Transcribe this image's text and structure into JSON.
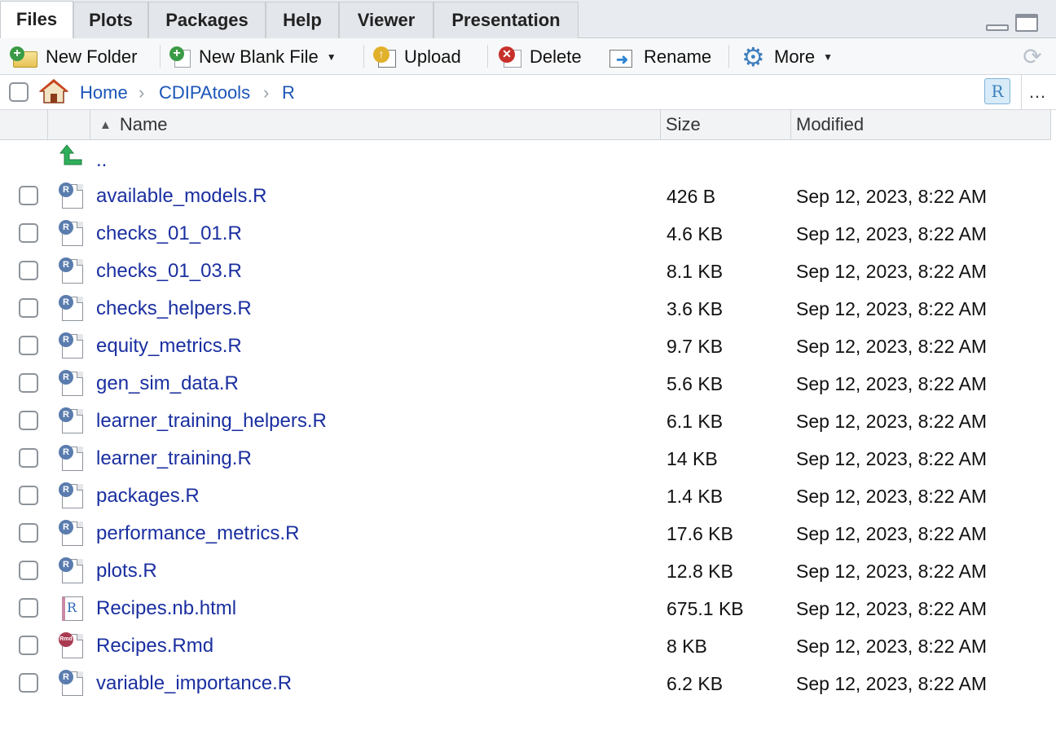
{
  "tabs": [
    {
      "label": "Files",
      "active": true
    },
    {
      "label": "Plots",
      "active": false
    },
    {
      "label": "Packages",
      "active": false
    },
    {
      "label": "Help",
      "active": false
    },
    {
      "label": "Viewer",
      "active": false
    },
    {
      "label": "Presentation",
      "active": false
    }
  ],
  "toolbar": {
    "new_folder": "New Folder",
    "new_blank_file": "New Blank File",
    "upload": "Upload",
    "delete": "Delete",
    "rename": "Rename",
    "more": "More"
  },
  "breadcrumb": {
    "home": "Home",
    "items": [
      "CDIPAtools",
      "R"
    ],
    "project_icon_label": "R"
  },
  "columns": {
    "name": "Name",
    "size": "Size",
    "modified": "Modified"
  },
  "parent_dir": "..",
  "files": [
    {
      "name": "available_models.R",
      "size": "426 B",
      "modified": "Sep 12, 2023, 8:22 AM",
      "icon": "r-script-icon"
    },
    {
      "name": "checks_01_01.R",
      "size": "4.6 KB",
      "modified": "Sep 12, 2023, 8:22 AM",
      "icon": "r-script-icon"
    },
    {
      "name": "checks_01_03.R",
      "size": "8.1 KB",
      "modified": "Sep 12, 2023, 8:22 AM",
      "icon": "r-script-icon"
    },
    {
      "name": "checks_helpers.R",
      "size": "3.6 KB",
      "modified": "Sep 12, 2023, 8:22 AM",
      "icon": "r-script-icon"
    },
    {
      "name": "equity_metrics.R",
      "size": "9.7 KB",
      "modified": "Sep 12, 2023, 8:22 AM",
      "icon": "r-script-icon"
    },
    {
      "name": "gen_sim_data.R",
      "size": "5.6 KB",
      "modified": "Sep 12, 2023, 8:22 AM",
      "icon": "r-script-icon"
    },
    {
      "name": "learner_training_helpers.R",
      "size": "6.1 KB",
      "modified": "Sep 12, 2023, 8:22 AM",
      "icon": "r-script-icon"
    },
    {
      "name": "learner_training.R",
      "size": "14 KB",
      "modified": "Sep 12, 2023, 8:22 AM",
      "icon": "r-script-icon"
    },
    {
      "name": "packages.R",
      "size": "1.4 KB",
      "modified": "Sep 12, 2023, 8:22 AM",
      "icon": "r-script-icon"
    },
    {
      "name": "performance_metrics.R",
      "size": "17.6 KB",
      "modified": "Sep 12, 2023, 8:22 AM",
      "icon": "r-script-icon"
    },
    {
      "name": "plots.R",
      "size": "12.8 KB",
      "modified": "Sep 12, 2023, 8:22 AM",
      "icon": "r-script-icon"
    },
    {
      "name": "Recipes.nb.html",
      "size": "675.1 KB",
      "modified": "Sep 12, 2023, 8:22 AM",
      "icon": "r-notebook-icon"
    },
    {
      "name": "Recipes.Rmd",
      "size": "8 KB",
      "modified": "Sep 12, 2023, 8:22 AM",
      "icon": "rmd-icon"
    },
    {
      "name": "variable_importance.R",
      "size": "6.2 KB",
      "modified": "Sep 12, 2023, 8:22 AM",
      "icon": "r-script-icon"
    }
  ],
  "colors": {
    "link": "#1a2fa0",
    "breadcrumb_link": "#1a55b8",
    "tabbar_bg": "#e8ebef"
  }
}
